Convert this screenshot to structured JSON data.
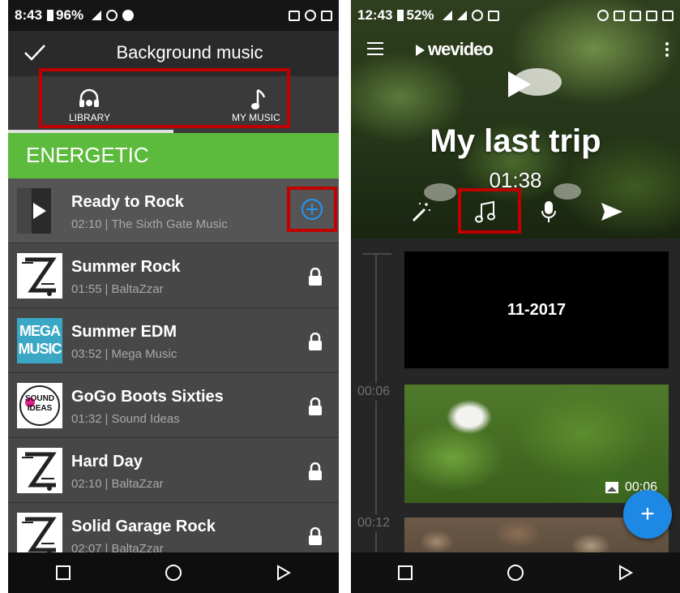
{
  "left_screen": {
    "status_bar": {
      "time": "8:43",
      "battery": "96%"
    },
    "header": {
      "title": "Background music"
    },
    "tabs": [
      {
        "label": "LIBRARY",
        "icon": "headphones-icon",
        "selected": true
      },
      {
        "label": "MY MUSIC",
        "icon": "music-note-icon",
        "selected": false
      }
    ],
    "genre": "ENERGETIC",
    "tracks": [
      {
        "name": "Ready to Rock",
        "duration": "02:10",
        "artist": "The Sixth Gate Music",
        "action": "add",
        "thumb": "play"
      },
      {
        "name": "Summer Rock",
        "duration": "01:55",
        "artist": "BaltaZzar",
        "action": "locked",
        "thumb": "baltazar"
      },
      {
        "name": "Summer EDM",
        "duration": "03:52",
        "artist": "Mega Music",
        "action": "locked",
        "thumb": "mega"
      },
      {
        "name": "GoGo Boots Sixties",
        "duration": "01:32",
        "artist": "Sound Ideas",
        "action": "locked",
        "thumb": "sound"
      },
      {
        "name": "Hard Day",
        "duration": "02:10",
        "artist": "BaltaZzar",
        "action": "locked",
        "thumb": "baltazar"
      },
      {
        "name": "Solid Garage Rock",
        "duration": "02:07",
        "artist": "BaltaZzar",
        "action": "locked",
        "thumb": "baltazar"
      }
    ],
    "thumb_text": {
      "mega_top": "MEGA",
      "mega_bottom": "MUSIC",
      "sound_top": "SOUND",
      "sound_bottom": "IDEAS"
    }
  },
  "right_screen": {
    "status_bar": {
      "time": "12:43",
      "battery": "52%"
    },
    "app_logo": "wevideo",
    "project": {
      "title": "My last trip",
      "duration": "01:38"
    },
    "timeline": {
      "timestamps": [
        "00:06",
        "00:12"
      ],
      "clips": [
        {
          "type": "title",
          "text": "11-2017"
        },
        {
          "type": "image",
          "duration": "00:06"
        },
        {
          "type": "image"
        }
      ]
    }
  },
  "colors": {
    "highlight_box": "#c00000",
    "genre_bar": "#5cba3c",
    "fab": "#1e88e5",
    "add_circle": "#2196f3"
  }
}
